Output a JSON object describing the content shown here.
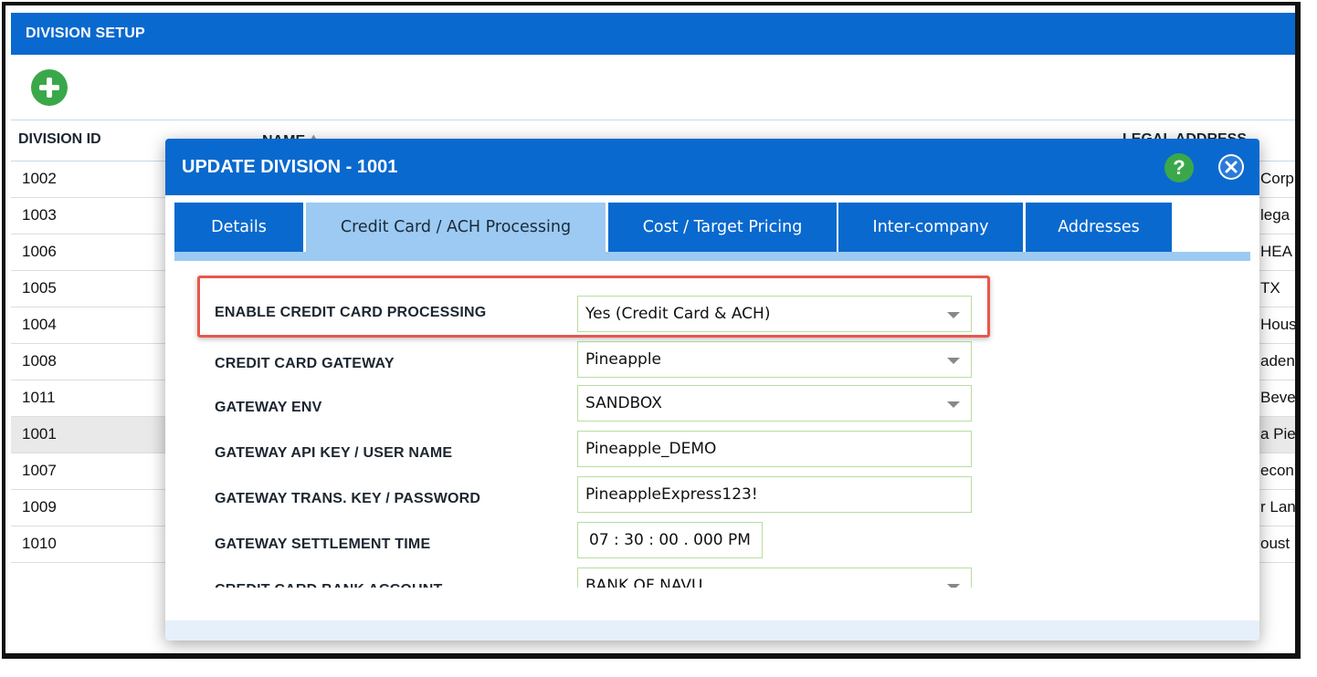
{
  "page": {
    "title": "DIVISION SETUP"
  },
  "grid": {
    "columns": {
      "id": "DIVISION ID",
      "name": "NAME",
      "name_sort_icon": "sort-ascending-icon",
      "address": "LEGAL ADDRESS"
    },
    "rows": [
      {
        "id": "1002",
        "address": "Corp"
      },
      {
        "id": "1003",
        "address": "lega"
      },
      {
        "id": "1006",
        "address": " HEA"
      },
      {
        "id": "1005",
        "address": "TX"
      },
      {
        "id": "1004",
        "address": "Hous"
      },
      {
        "id": "1008",
        "address": "aden"
      },
      {
        "id": "1011",
        "address": "Beve"
      },
      {
        "id": "1001",
        "address": "a Pie",
        "selected": true
      },
      {
        "id": "1007",
        "address": "econ"
      },
      {
        "id": "1009",
        "address": "r Lan"
      },
      {
        "id": "1010",
        "address": "oust"
      }
    ]
  },
  "modal": {
    "title": "UPDATE DIVISION - 1001",
    "help_label": "?",
    "tabs": [
      {
        "label": "Details"
      },
      {
        "label": "Credit Card / ACH Processing",
        "active": true
      },
      {
        "label": "Cost / Target Pricing"
      },
      {
        "label": "Inter-company"
      },
      {
        "label": "Addresses"
      }
    ],
    "fields": [
      {
        "label": "ENABLE CREDIT CARD PROCESSING",
        "value": "Yes (Credit Card & ACH)",
        "type": "select"
      },
      {
        "label": "CREDIT CARD GATEWAY",
        "value": "Pineapple",
        "type": "select"
      },
      {
        "label": "GATEWAY ENV",
        "value": "SANDBOX",
        "type": "select"
      },
      {
        "label": "GATEWAY API KEY / USER NAME",
        "value": "Pineapple_DEMO",
        "type": "text"
      },
      {
        "label": "GATEWAY TRANS. KEY / PASSWORD",
        "value": "PineappleExpress123!",
        "type": "text"
      },
      {
        "label": "GATEWAY SETTLEMENT TIME",
        "value": "07 : 30 : 00 . 000   PM",
        "type": "time"
      },
      {
        "label": "CREDIT CARD BANK ACCOUNT",
        "value": "BANK OF NAVU",
        "type": "select"
      }
    ]
  },
  "colors": {
    "primary": "#0a69ce",
    "tab_active": "#9ccaf2",
    "add": "#3aa84a",
    "highlight": "#e9564b"
  }
}
